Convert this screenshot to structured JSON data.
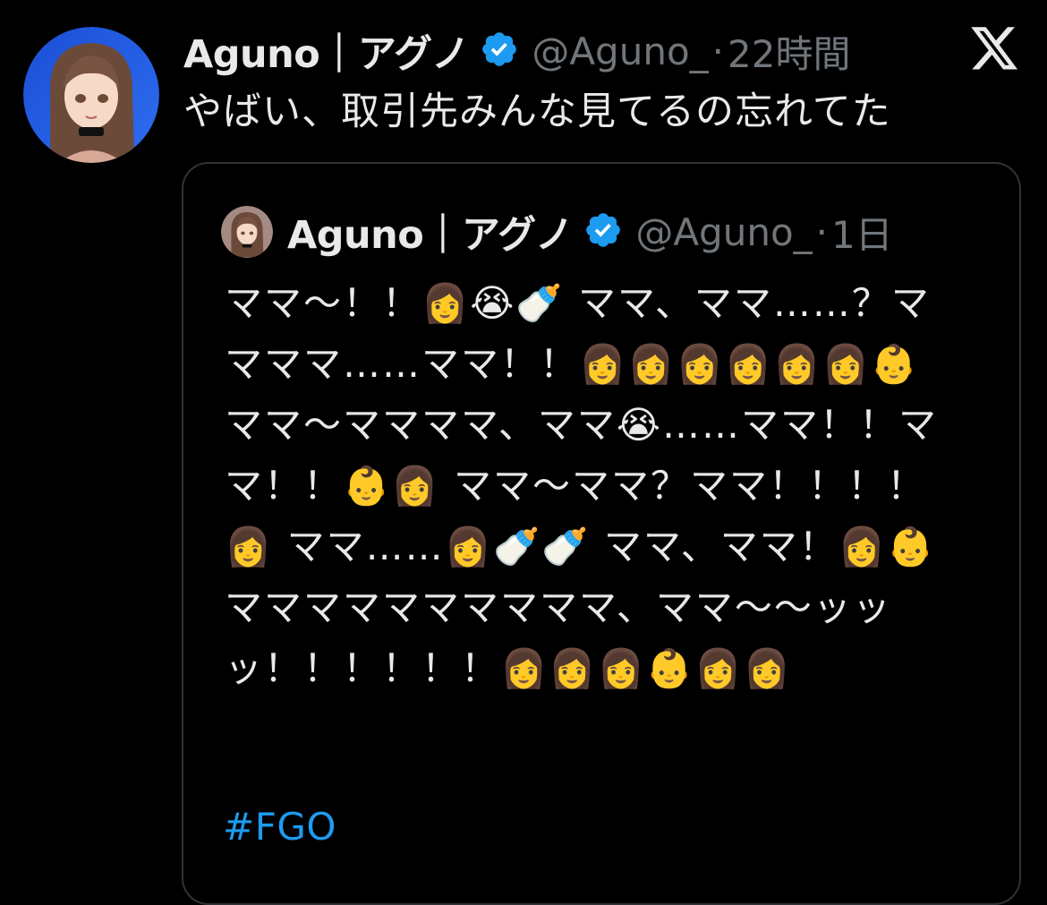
{
  "tweet": {
    "author": {
      "display_name": "Aguno｜アグノ",
      "handle": "@Aguno_",
      "verified": true,
      "avatar_icon": "anime-girl-avatar"
    },
    "dot": "·",
    "time": "22時間",
    "platform_icon": "x-logo-icon",
    "text": "やばい、取引先みんな見てるの忘れてた"
  },
  "quote": {
    "author": {
      "display_name": "Aguno｜アグノ",
      "handle": "@Aguno_",
      "verified": true,
      "avatar_icon": "anime-girl-avatar"
    },
    "dot": "·",
    "time": "1日",
    "text": "ママ〜！！👩😭🍼 ママ、ママ……？ママママ……ママ！！👩👩👩👩👩👩👶 ママ〜ママママ、ママ😭……ママ！！ママ！！👶👩 ママ〜ママ？ママ！！！！👩 ママ……👩🍼🍼 ママ、ママ！👩👶 ママママママママママ、ママ〜〜ッッッ！！！！！！👩👩👩👶👩👩",
    "hashtag": "#FGO"
  },
  "colors": {
    "background": "#000000",
    "text_primary": "#e7e9ea",
    "text_secondary": "#71767b",
    "accent_blue": "#1d9bf0",
    "card_border": "#2f3336"
  }
}
